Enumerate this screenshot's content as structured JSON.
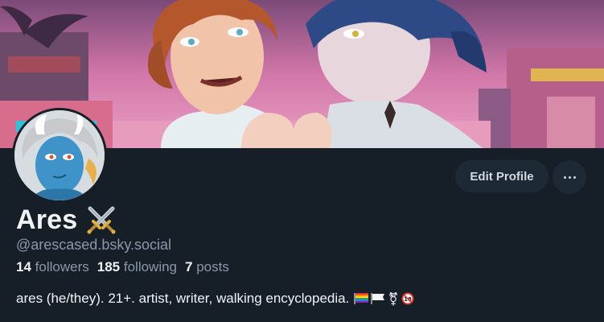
{
  "profile": {
    "display_name": "Ares",
    "handle": "@arescased.bsky.social",
    "stats": {
      "followers_count": "14",
      "followers_label": "followers",
      "following_count": "185",
      "following_label": "following",
      "posts_count": "7",
      "posts_label": "posts"
    },
    "bio": "ares (he/they). 21+. artist, writer, walking encyclopedia.",
    "bio_emojis": [
      "rainbow-flag",
      "white-flag",
      "transgender-symbol",
      "no-under-18"
    ]
  },
  "actions": {
    "edit_profile_label": "Edit Profile",
    "more_icon": "ellipsis-icon"
  },
  "colors": {
    "background": "#161e27",
    "button_bg": "#1e2936",
    "muted_text": "#8b98a8",
    "primary_text": "#f1f3f5"
  }
}
